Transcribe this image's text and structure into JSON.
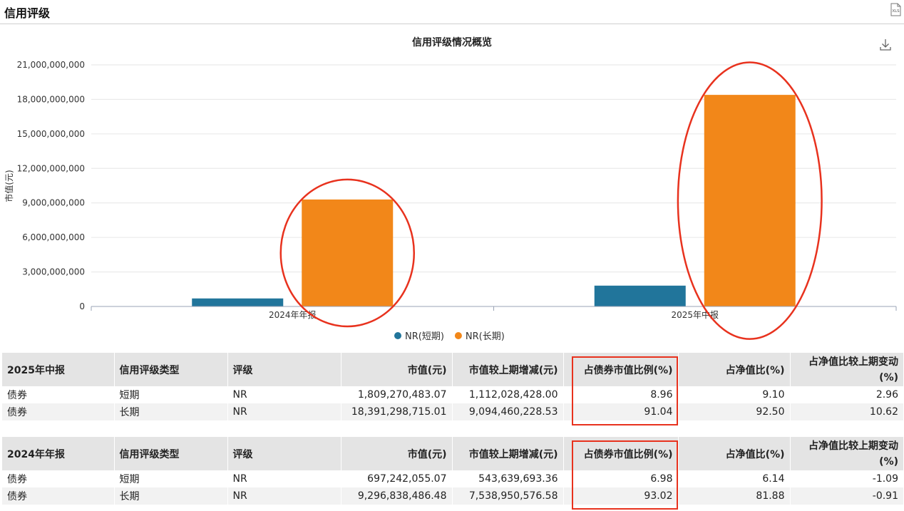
{
  "section": {
    "title": "信用评级",
    "xls_label": "XLS"
  },
  "icons": {
    "download": "download-icon",
    "export": "xls-export-icon"
  },
  "chart_data": {
    "type": "bar",
    "title": "信用评级情况概览",
    "ylabel": "市值(元)",
    "xlabel": "",
    "categories": [
      "2024年年报",
      "2025年中报"
    ],
    "ylim": [
      0,
      21000000000
    ],
    "yticks": [
      "0",
      "3,000,000,000",
      "6,000,000,000",
      "9,000,000,000",
      "12,000,000,000",
      "15,000,000,000",
      "18,000,000,000",
      "21,000,000,000"
    ],
    "ytick_values": [
      0,
      3000000000,
      6000000000,
      9000000000,
      12000000000,
      15000000000,
      18000000000,
      21000000000
    ],
    "series": [
      {
        "name": "NR(短期)",
        "color": "#21759b",
        "values": [
          697242055.07,
          1809270483.07
        ]
      },
      {
        "name": "NR(长期)",
        "color": "#f28719",
        "values": [
          9296838486.48,
          18391298715.01
        ]
      }
    ],
    "legend_position": "bottom",
    "grid": true,
    "annotation_color": "#e8321e"
  },
  "tables": [
    {
      "headers": [
        "2025年中报",
        "信用评级类型",
        "评级",
        "市值(元)",
        "市值较上期增减(元)",
        "占债券市值比例(%)",
        "占净值比(%)",
        "占净值比较上期变动(%)"
      ],
      "rows": [
        [
          "债券",
          "短期",
          "NR",
          "1,809,270,483.07",
          "1,112,028,428.00",
          "8.96",
          "9.10",
          "2.96"
        ],
        [
          "债券",
          "长期",
          "NR",
          "18,391,298,715.01",
          "9,094,460,228.53",
          "91.04",
          "92.50",
          "10.62"
        ]
      ]
    },
    {
      "headers": [
        "2024年年报",
        "信用评级类型",
        "评级",
        "市值(元)",
        "市值较上期增减(元)",
        "占债券市值比例(%)",
        "占净值比(%)",
        "占净值比较上期变动(%)"
      ],
      "rows": [
        [
          "债券",
          "短期",
          "NR",
          "697,242,055.07",
          "543,639,693.36",
          "6.98",
          "6.14",
          "-1.09"
        ],
        [
          "债券",
          "长期",
          "NR",
          "9,296,838,486.48",
          "7,538,950,576.58",
          "93.02",
          "81.88",
          "-0.91"
        ]
      ]
    }
  ]
}
